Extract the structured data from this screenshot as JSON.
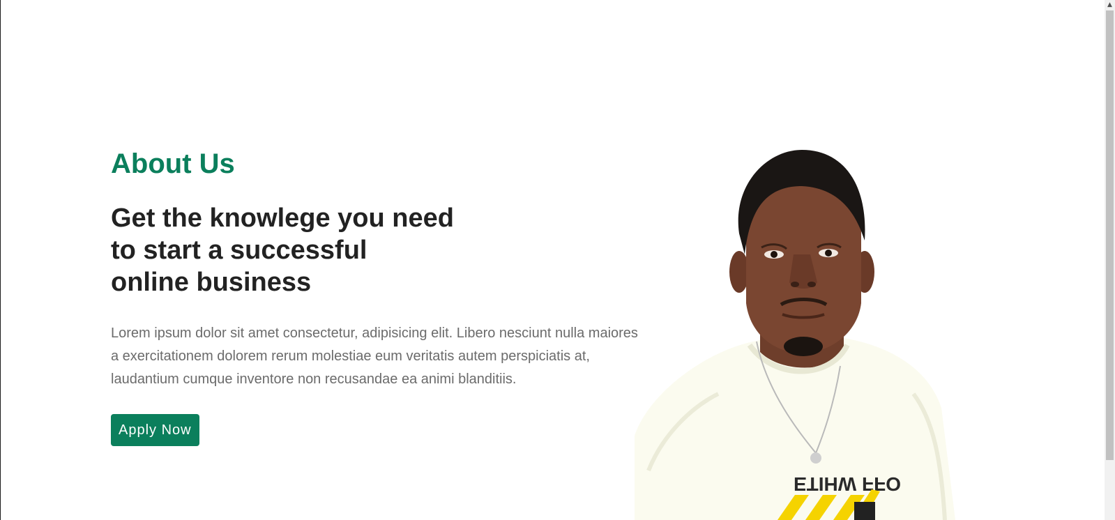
{
  "about": {
    "section_label": "About Us",
    "headline_lines": [
      "Get the knowlege you need",
      "to start a successful",
      "online business"
    ],
    "body": "Lorem ipsum dolor sit amet consectetur, adipisicing elit. Libero nesciunt nulla maiores a exercitationem dolorem rerum molestiae eum veritatis autem perspiciatis at, laudantium cumque inventore non recusandae ea animi blanditiis.",
    "cta_label": "Apply Now"
  },
  "image": {
    "subject": "portrait-person",
    "shirt_text": "OFF WHITE"
  },
  "colors": {
    "accent": "#0b7f5c",
    "heading": "#222222",
    "body": "#6b6b6b",
    "background": "#ffffff"
  },
  "scrollbar": {
    "up_icon": "chevron-up-icon"
  }
}
